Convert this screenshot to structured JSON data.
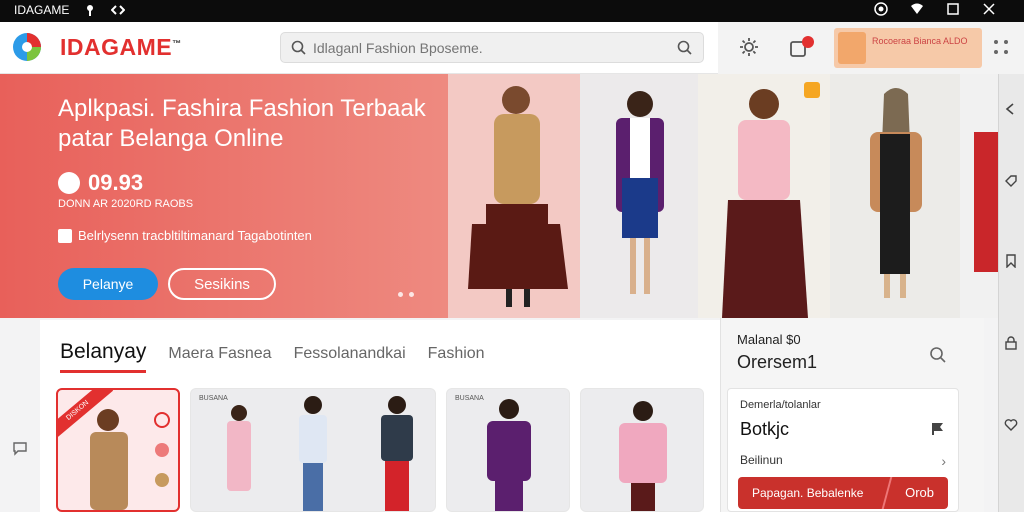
{
  "statusbar": {
    "app_name": "IDAGAME",
    "left_icons": [
      "pin-icon",
      "code-icon"
    ],
    "right_icons": [
      "camera-icon",
      "wifi-icon",
      "window-icon",
      "close-icon"
    ]
  },
  "header": {
    "brand": "IDAGAME",
    "trademark": "™",
    "search_placeholder": "Idlaganl Fashion Bposeme.",
    "promo_text": "Rocoeraa Bianca ALDO"
  },
  "hero": {
    "title": "Aplkpasi. Fashira Fashion Terbaak patar Belanga Online",
    "price": "09.93",
    "subtitle": "DONN AR 2020RD RAOBS",
    "note": "Belrlysenn tracbltiltimanard Tagabotinten",
    "primary_button": "Pelanye",
    "secondary_button": "Sesikins"
  },
  "tabs": [
    {
      "label": "Belanyay",
      "active": true
    },
    {
      "label": "Maera Fasnea",
      "active": false
    },
    {
      "label": "Fessolanandkai",
      "active": false
    },
    {
      "label": "Fashion",
      "active": false
    }
  ],
  "products": {
    "ribbon": "DISKON",
    "card2_label": "BUSANA",
    "card4_label": "BUSANA"
  },
  "side_panel": {
    "heading1": "Malanal $0",
    "heading2": "Orersem1",
    "inner_label": "Demerla/tolanlar",
    "inner_big": "Botkjc",
    "inner_row": "Beilinun",
    "button_left": "Papagan. Bebalenke",
    "button_right": "Orob"
  },
  "colors": {
    "brand_red": "#e2302f",
    "hero_bg": "#e8605a",
    "primary_button": "#1e8de0",
    "side_button": "#c9312c"
  }
}
